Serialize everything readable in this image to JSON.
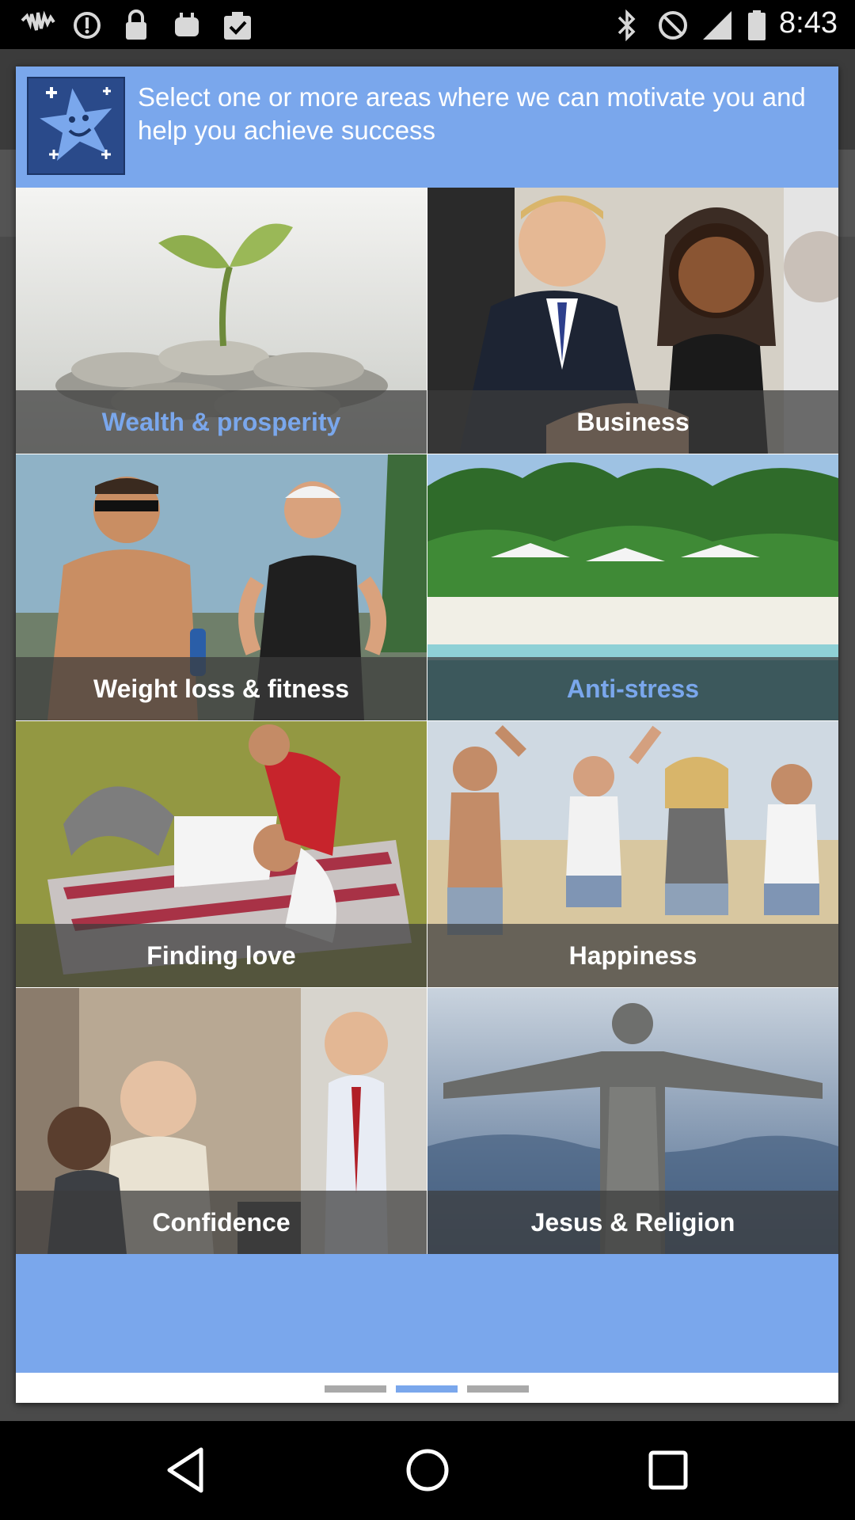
{
  "status_bar": {
    "time": "8:43",
    "icons_left": [
      "wifi-signal-icon",
      "sync-icon",
      "lock-icon",
      "android-icon",
      "clipboard-check-icon"
    ],
    "icons_right": [
      "bluetooth-icon",
      "mute-icon",
      "signal-icon",
      "battery-icon"
    ]
  },
  "dialog": {
    "header_text": "Select one or more areas where we can motivate you and help you achieve success",
    "logo_icon": "smiling-star-icon",
    "categories": [
      {
        "label": "Wealth & prosperity",
        "selected": true
      },
      {
        "label": "Business",
        "selected": false
      },
      {
        "label": "Weight loss & fitness",
        "selected": false
      },
      {
        "label": "Anti-stress",
        "selected": true
      },
      {
        "label": "Finding love",
        "selected": false
      },
      {
        "label": "Happiness",
        "selected": false
      },
      {
        "label": "Confidence",
        "selected": false
      },
      {
        "label": "Jesus & Religion",
        "selected": false
      }
    ],
    "pager": {
      "pages": 3,
      "active_page": 2
    }
  },
  "colors": {
    "accent": "#7aa7ec",
    "caption_bg": "#3c3c3c",
    "selected_text": "#7aa7ec"
  },
  "nav_bar": {
    "buttons": [
      "back-icon",
      "home-icon",
      "recents-icon"
    ]
  }
}
